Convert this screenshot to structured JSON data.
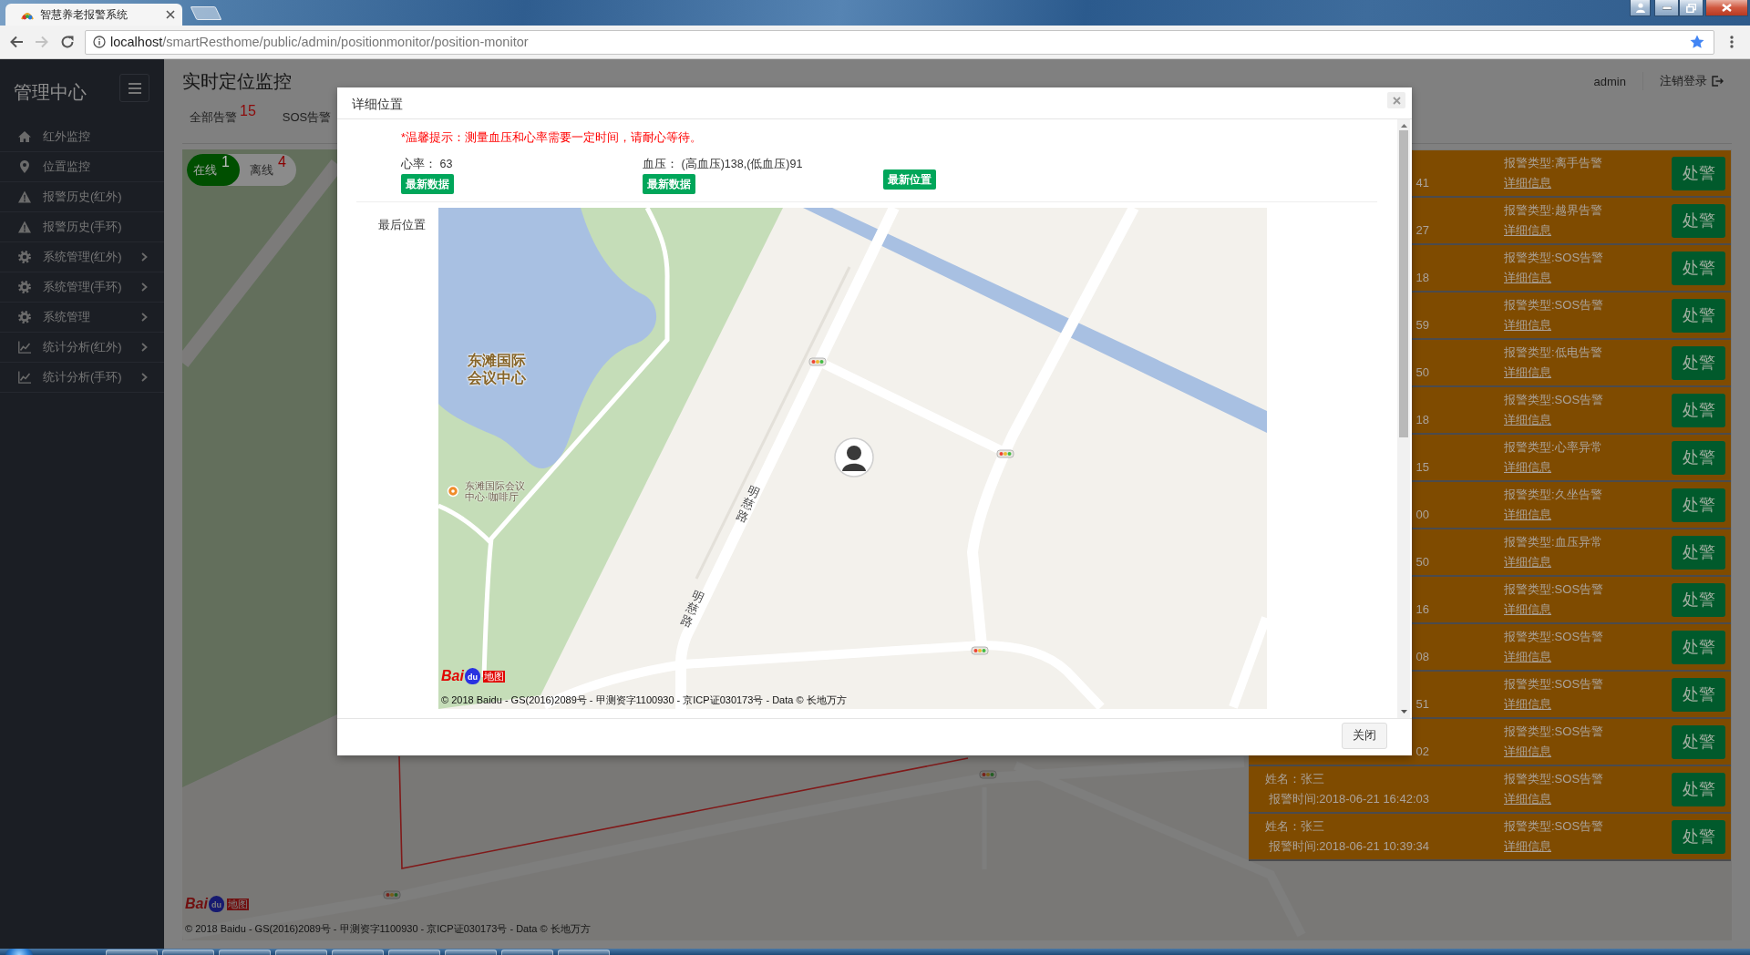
{
  "browser": {
    "tab_title": "智慧养老报警系统",
    "url_host": "localhost",
    "url_path": "/smartResthome/public/admin/positionmonitor/position-monitor"
  },
  "sidebar": {
    "title": "管理中心",
    "items": [
      {
        "label": "红外监控",
        "submenu": false
      },
      {
        "label": "位置监控",
        "submenu": false
      },
      {
        "label": "报警历史(红外)",
        "submenu": false
      },
      {
        "label": "报警历史(手环)",
        "submenu": false
      },
      {
        "label": "系统管理(红外)",
        "submenu": true
      },
      {
        "label": "系统管理(手环)",
        "submenu": true
      },
      {
        "label": "系统管理",
        "submenu": true
      },
      {
        "label": "统计分析(红外)",
        "submenu": true
      },
      {
        "label": "统计分析(手环)",
        "submenu": true
      }
    ]
  },
  "header": {
    "title": "实时定位监控",
    "user": "admin",
    "logout": "注销登录"
  },
  "tabs": [
    {
      "label": "全部告警",
      "count": "15"
    },
    {
      "label": "SOS告警"
    }
  ],
  "map": {
    "status_toggle": [
      {
        "label": "在线",
        "count": "1",
        "selected": true
      },
      {
        "label": "离线",
        "count": "4",
        "selected": false
      }
    ],
    "logo": [
      "Bai",
      "du",
      "地图"
    ],
    "copyright": "© 2018 Baidu - GS(2016)2089号 - 甲测资字1100930 - 京ICP证030173号 - Data © 长地万方"
  },
  "alerts": [
    {
      "time": "41",
      "type": "报警类型:离手告警",
      "details": "详细信息",
      "action": "处警"
    },
    {
      "time": "27",
      "type": "报警类型:越界告警",
      "details": "详细信息",
      "action": "处警"
    },
    {
      "time": "18",
      "type": "报警类型:SOS告警",
      "details": "详细信息",
      "action": "处警"
    },
    {
      "time": "59",
      "type": "报警类型:SOS告警",
      "details": "详细信息",
      "action": "处警"
    },
    {
      "time": "50",
      "type": "报警类型:低电告警",
      "details": "详细信息",
      "action": "处警"
    },
    {
      "time": "18",
      "type": "报警类型:SOS告警",
      "details": "详细信息",
      "action": "处警"
    },
    {
      "time": "15",
      "type": "报警类型:心率异常",
      "details": "详细信息",
      "action": "处警"
    },
    {
      "time": "00",
      "type": "报警类型:久坐告警",
      "details": "详细信息",
      "action": "处警"
    },
    {
      "time": "50",
      "type": "报警类型:血压异常",
      "details": "详细信息",
      "action": "处警"
    },
    {
      "time": "16",
      "type": "报警类型:SOS告警",
      "details": "详细信息",
      "action": "处警"
    },
    {
      "time": "08",
      "type": "报警类型:SOS告警",
      "details": "详细信息",
      "action": "处警"
    },
    {
      "time": "51",
      "type": "报警类型:SOS告警",
      "details": "详细信息",
      "action": "处警"
    },
    {
      "time": "02",
      "type": "报警类型:SOS告警",
      "details": "详细信息",
      "action": "处警"
    },
    {
      "name": "姓名：张三",
      "time": "报警时间:2018-06-21 16:42:03",
      "type": "报警类型:SOS告警",
      "details": "详细信息",
      "action": "处警"
    },
    {
      "name": "姓名：张三",
      "time": "报警时间:2018-06-21 10:39:34",
      "type": "报警类型:SOS告警",
      "details": "详细信息",
      "action": "处警"
    }
  ],
  "dialog": {
    "title": "详细位置",
    "notice": "*温馨提示：测量血压和心率需要一定时间，请耐心等待。",
    "readings": [
      {
        "text": "心率： 63",
        "button": "最新数据"
      },
      {
        "text": "血压： (高血压)138,(低血压)91",
        "button": "最新数据"
      },
      {
        "button": "最新位置"
      }
    ],
    "map_label": "最后位置",
    "map": {
      "place_label": "东滩国际会议中心",
      "poi_label": "东滩国际会议中心·咖啡厅",
      "road_labels": [
        "明慈路",
        "明慈路"
      ],
      "logo": [
        "Bai",
        "du",
        "地图"
      ],
      "copyright": "© 2018 Baidu - GS(2016)2089号 - 甲测资字1100930 - 京ICP证030173号 - Data © 长地万方"
    },
    "close": "关闭"
  }
}
